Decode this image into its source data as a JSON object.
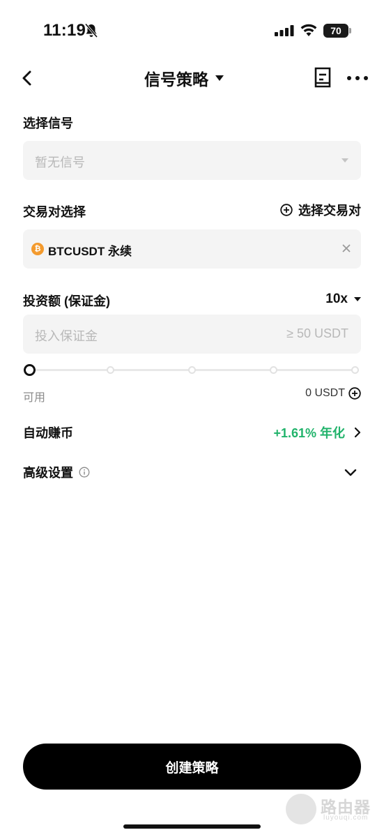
{
  "status_bar": {
    "time": "11:19",
    "battery": "70"
  },
  "header": {
    "title": "信号策略"
  },
  "signal": {
    "label": "选择信号",
    "placeholder": "暂无信号"
  },
  "pair": {
    "label": "交易对选择",
    "select_action": "选择交易对",
    "selected": "BTCUSDT 永续",
    "coin_symbol": "₿"
  },
  "investment": {
    "label": "投资额 (保证金)",
    "leverage": "10x",
    "placeholder": "投入保证金",
    "min_hint": "≥ 50 USDT",
    "slider_value_fraction": 0
  },
  "available": {
    "label": "可用",
    "value": "0 USDT"
  },
  "auto_earn": {
    "label": "自动赚币",
    "rate": "+1.61% 年化"
  },
  "advanced": {
    "label": "高级设置"
  },
  "create_button": {
    "label": "创建策略"
  },
  "watermark": {
    "text": "路由器",
    "sub": "luyouqi.com"
  },
  "colors": {
    "accent_green": "#21b36b",
    "btc_orange": "#f39a2d",
    "button_black": "#000000"
  }
}
